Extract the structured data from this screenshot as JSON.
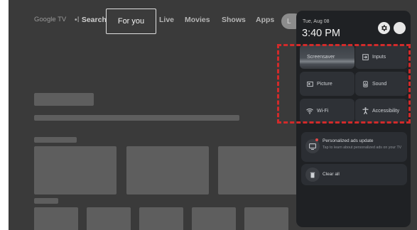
{
  "nav": {
    "brand": "Google TV",
    "search": "Search",
    "tabs": [
      "For you",
      "Live",
      "Movies",
      "Shows",
      "Apps"
    ],
    "avatar_letter": "L"
  },
  "quick_settings": {
    "date": "Tue, Aug 08",
    "time": "3:40 PM",
    "tiles": [
      {
        "label": "Screensaver",
        "icon": "screensaver-icon"
      },
      {
        "label": "Inputs",
        "icon": "input-icon"
      },
      {
        "label": "Picture",
        "icon": "picture-icon"
      },
      {
        "label": "Sound",
        "icon": "speaker-icon"
      },
      {
        "label": "Wi-Fi",
        "icon": "wifi-icon"
      },
      {
        "label": "Accessibility",
        "icon": "accessibility-icon"
      }
    ],
    "notification": {
      "title": "Personalized ads update",
      "body": "Tap to learn about personalized ads on your TV"
    },
    "clear_all": "Clear all"
  },
  "colors": {
    "highlight": "#d22a2a",
    "panel": "#1f2124",
    "tile": "#2e3136"
  }
}
